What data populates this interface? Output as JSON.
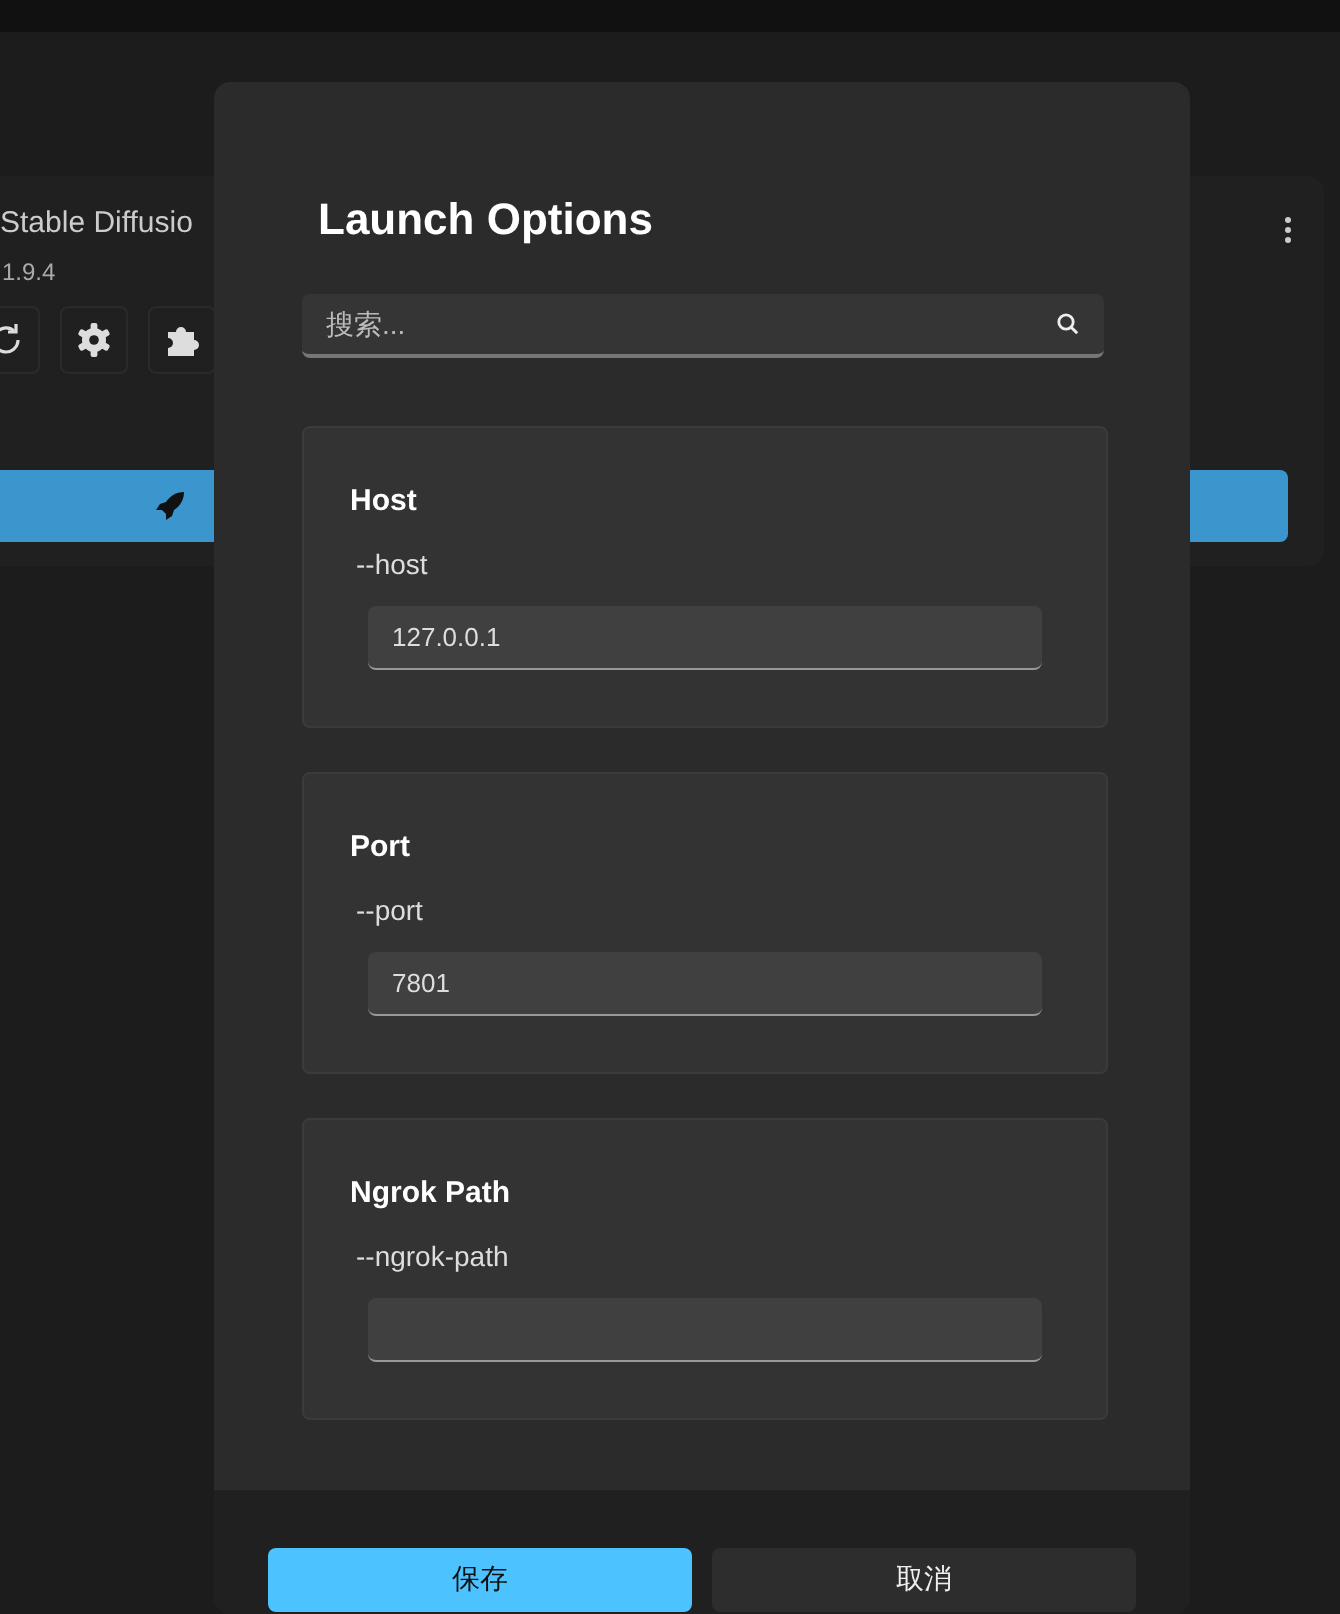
{
  "background_card": {
    "title": "Stable Diffusio",
    "version": "1.9.4"
  },
  "dialog": {
    "title": "Launch Options",
    "search": {
      "placeholder": "搜索..."
    },
    "options": [
      {
        "label": "Host",
        "flag": "--host",
        "value": "127.0.0.1"
      },
      {
        "label": "Port",
        "flag": "--port",
        "value": "7801"
      },
      {
        "label": "Ngrok Path",
        "flag": "--ngrok-path"
      }
    ],
    "buttons": [
      {
        "label": "保存",
        "kind": "primary"
      },
      {
        "label": "取消",
        "kind": "secondary"
      }
    ]
  }
}
